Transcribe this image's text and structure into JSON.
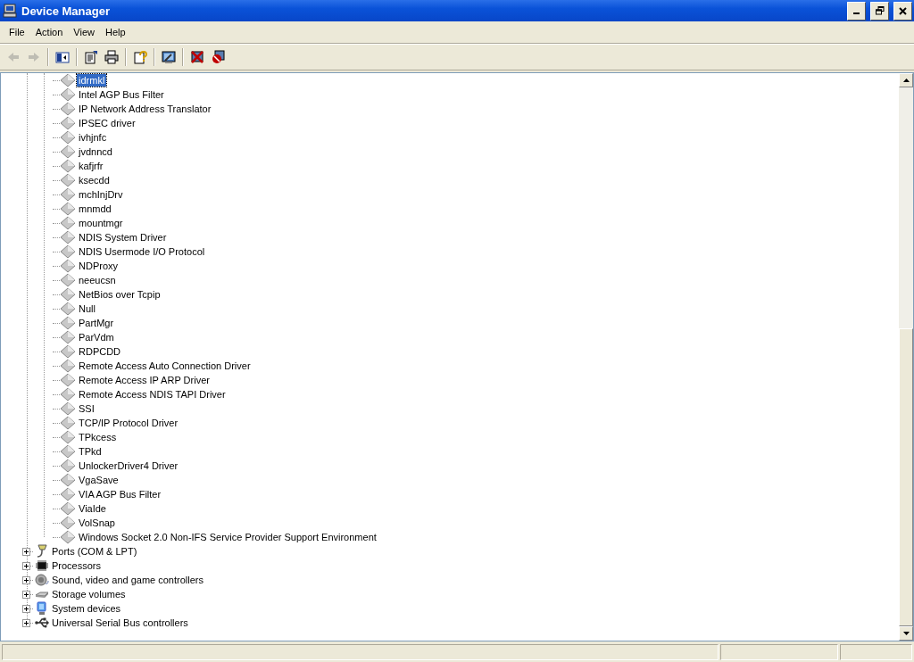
{
  "window": {
    "title": "Device Manager"
  },
  "menu": [
    "File",
    "Action",
    "View",
    "Help"
  ],
  "toolbar": [
    {
      "kind": "back",
      "disabled": true
    },
    {
      "kind": "forward",
      "disabled": true
    },
    {
      "kind": "console-tree",
      "disabled": false
    },
    {
      "kind": "properties",
      "disabled": false
    },
    {
      "kind": "print",
      "disabled": false
    },
    {
      "kind": "help",
      "disabled": false
    },
    {
      "kind": "scan",
      "disabled": false
    },
    {
      "kind": "uninstall",
      "disabled": false
    },
    {
      "kind": "disable",
      "disabled": false
    }
  ],
  "tree": {
    "continued_children": [
      {
        "label": "idrmkl",
        "selected": true
      },
      {
        "label": "Intel AGP Bus Filter",
        "selected": false
      },
      {
        "label": "IP Network Address Translator",
        "selected": false
      },
      {
        "label": "IPSEC driver",
        "selected": false
      },
      {
        "label": "ivhjnfc",
        "selected": false
      },
      {
        "label": "jvdnncd",
        "selected": false
      },
      {
        "label": "kafjrfr",
        "selected": false
      },
      {
        "label": "ksecdd",
        "selected": false
      },
      {
        "label": "mchInjDrv",
        "selected": false
      },
      {
        "label": "mnmdd",
        "selected": false
      },
      {
        "label": "mountmgr",
        "selected": false
      },
      {
        "label": "NDIS System Driver",
        "selected": false
      },
      {
        "label": "NDIS Usermode I/O Protocol",
        "selected": false
      },
      {
        "label": "NDProxy",
        "selected": false
      },
      {
        "label": "neeucsn",
        "selected": false
      },
      {
        "label": "NetBios over Tcpip",
        "selected": false
      },
      {
        "label": "Null",
        "selected": false
      },
      {
        "label": "PartMgr",
        "selected": false
      },
      {
        "label": "ParVdm",
        "selected": false
      },
      {
        "label": "RDPCDD",
        "selected": false
      },
      {
        "label": "Remote Access Auto Connection Driver",
        "selected": false
      },
      {
        "label": "Remote Access IP ARP Driver",
        "selected": false
      },
      {
        "label": "Remote Access NDIS TAPI Driver",
        "selected": false
      },
      {
        "label": "SSI",
        "selected": false
      },
      {
        "label": "TCP/IP Protocol Driver",
        "selected": false
      },
      {
        "label": "TPkcess",
        "selected": false
      },
      {
        "label": "TPkd",
        "selected": false
      },
      {
        "label": "UnlockerDriver4 Driver",
        "selected": false
      },
      {
        "label": "VgaSave",
        "selected": false
      },
      {
        "label": "VIA AGP Bus Filter",
        "selected": false
      },
      {
        "label": "ViaIde",
        "selected": false
      },
      {
        "label": "VolSnap",
        "selected": false
      },
      {
        "label": "Windows Socket 2.0 Non-IFS Service Provider Support Environment",
        "selected": false
      }
    ],
    "categories": [
      {
        "label": "Ports (COM & LPT)",
        "kind": "port",
        "expanded": false,
        "selected": false
      },
      {
        "label": "Processors",
        "kind": "processor",
        "expanded": false,
        "selected": false
      },
      {
        "label": "Sound, video and game controllers",
        "kind": "sound",
        "expanded": false,
        "selected": false
      },
      {
        "label": "Storage volumes",
        "kind": "storage",
        "expanded": false,
        "selected": false
      },
      {
        "label": "System devices",
        "kind": "system",
        "expanded": false,
        "selected": false
      },
      {
        "label": "Universal Serial Bus controllers",
        "kind": "usb",
        "expanded": false,
        "selected": false
      }
    ]
  }
}
